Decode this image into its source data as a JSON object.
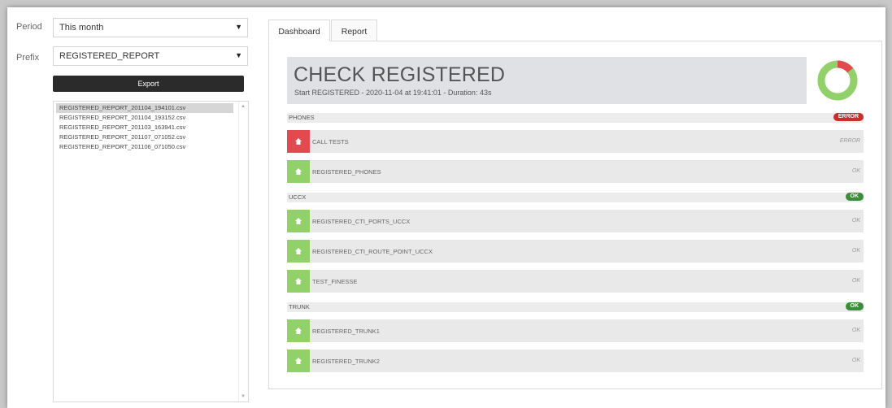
{
  "filters": {
    "period_label": "Period",
    "period_value": "This month",
    "prefix_label": "Prefix",
    "prefix_value": "REGISTERED_REPORT",
    "export_label": "Export"
  },
  "files": [
    "REGISTERED_REPORT_201104_194101.csv",
    "REGISTERED_REPORT_201104_193152.csv",
    "REGISTERED_REPORT_201103_163941.csv",
    "REGISTERED_REPORT_201107_071052.csv",
    "REGISTERED_REPORT_201106_071050.csv"
  ],
  "tabs": {
    "dashboard": "Dashboard",
    "report": "Report"
  },
  "header": {
    "title": "CHECK REGISTERED",
    "subtitle": "Start REGISTERED - 2020-11-04 at 19:41:01 - Duration: 43s"
  },
  "donut": {
    "ok_fraction": 0.857,
    "error_fraction": 0.143,
    "ok_color": "#92d06a",
    "error_color": "#e24a4f"
  },
  "sections": {
    "phones": {
      "name": "PHONES",
      "badge": "ERROR",
      "rows": [
        {
          "name": "CALL TESTS",
          "status": "ERROR"
        },
        {
          "name": "REGISTERED_PHONES",
          "status": "OK"
        }
      ]
    },
    "uccx": {
      "name": "UCCX",
      "badge": "OK",
      "rows": [
        {
          "name": "REGISTERED_CTI_PORTS_UCCX",
          "status": "OK"
        },
        {
          "name": "REGISTERED_CTI_ROUTE_POINT_UCCX",
          "status": "OK"
        },
        {
          "name": "TEST_FINESSE",
          "status": "OK"
        }
      ]
    },
    "trunk": {
      "name": "TRUNK",
      "badge": "OK",
      "rows": [
        {
          "name": "REGISTERED_TRUNK1",
          "status": "OK"
        },
        {
          "name": "REGISTERED_TRUNK2",
          "status": "OK"
        }
      ]
    }
  }
}
